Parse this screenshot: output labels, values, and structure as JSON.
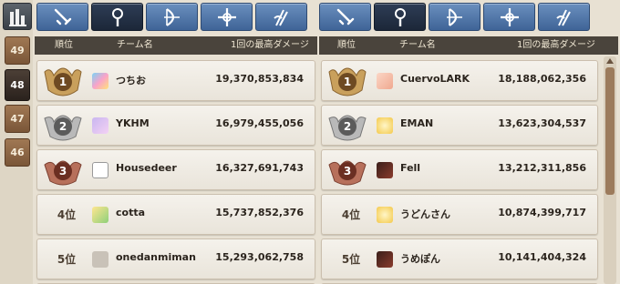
{
  "rail": {
    "top_icon": "chart-bars-icon",
    "items": [
      {
        "label": "49",
        "active": false
      },
      {
        "label": "48",
        "active": true
      },
      {
        "label": "47",
        "active": false
      },
      {
        "label": "46",
        "active": false
      }
    ]
  },
  "tabs": [
    {
      "icon": "sword-icon",
      "active": false
    },
    {
      "icon": "staff-orb-icon",
      "active": true
    },
    {
      "icon": "bow-icon",
      "active": false
    },
    {
      "icon": "cross-sparkle-icon",
      "active": false
    },
    {
      "icon": "wing-blade-icon",
      "active": false
    }
  ],
  "columns": {
    "rank": "順位",
    "team": "チーム名",
    "damage": "1回の最高ダメージ"
  },
  "left": {
    "rows": [
      {
        "rank": "1",
        "rank_label": "",
        "medal": "gold",
        "name": "つちお",
        "score": "19,370,853,834"
      },
      {
        "rank": "2",
        "rank_label": "",
        "medal": "silver",
        "name": "YKHM",
        "score": "16,979,455,056"
      },
      {
        "rank": "3",
        "rank_label": "",
        "medal": "bronze",
        "name": "Housedeer",
        "score": "16,327,691,743"
      },
      {
        "rank": "4",
        "rank_label": "4位",
        "medal": "",
        "name": "cotta",
        "score": "15,737,852,376"
      },
      {
        "rank": "5",
        "rank_label": "5位",
        "medal": "",
        "name": "onedanmiman",
        "score": "15,293,062,758"
      }
    ]
  },
  "right": {
    "rows": [
      {
        "rank": "1",
        "rank_label": "",
        "medal": "gold",
        "name": "CuervoLARK",
        "score": "18,188,062,356"
      },
      {
        "rank": "2",
        "rank_label": "",
        "medal": "silver",
        "name": "EMAN",
        "score": "13,623,304,537"
      },
      {
        "rank": "3",
        "rank_label": "",
        "medal": "bronze",
        "name": "Fell",
        "score": "13,212,311,856"
      },
      {
        "rank": "4",
        "rank_label": "4位",
        "medal": "",
        "name": "うどんさん",
        "score": "10,874,399,717"
      },
      {
        "rank": "5",
        "rank_label": "5位",
        "medal": "",
        "name": "うめぽん",
        "score": "10,141,404,324"
      }
    ]
  },
  "colors": {
    "gold": "#c9a05c",
    "silver": "#b9b9b9",
    "bronze": "#b7705b",
    "tab_blue": "#4f74a6",
    "header": "#4a443c"
  }
}
